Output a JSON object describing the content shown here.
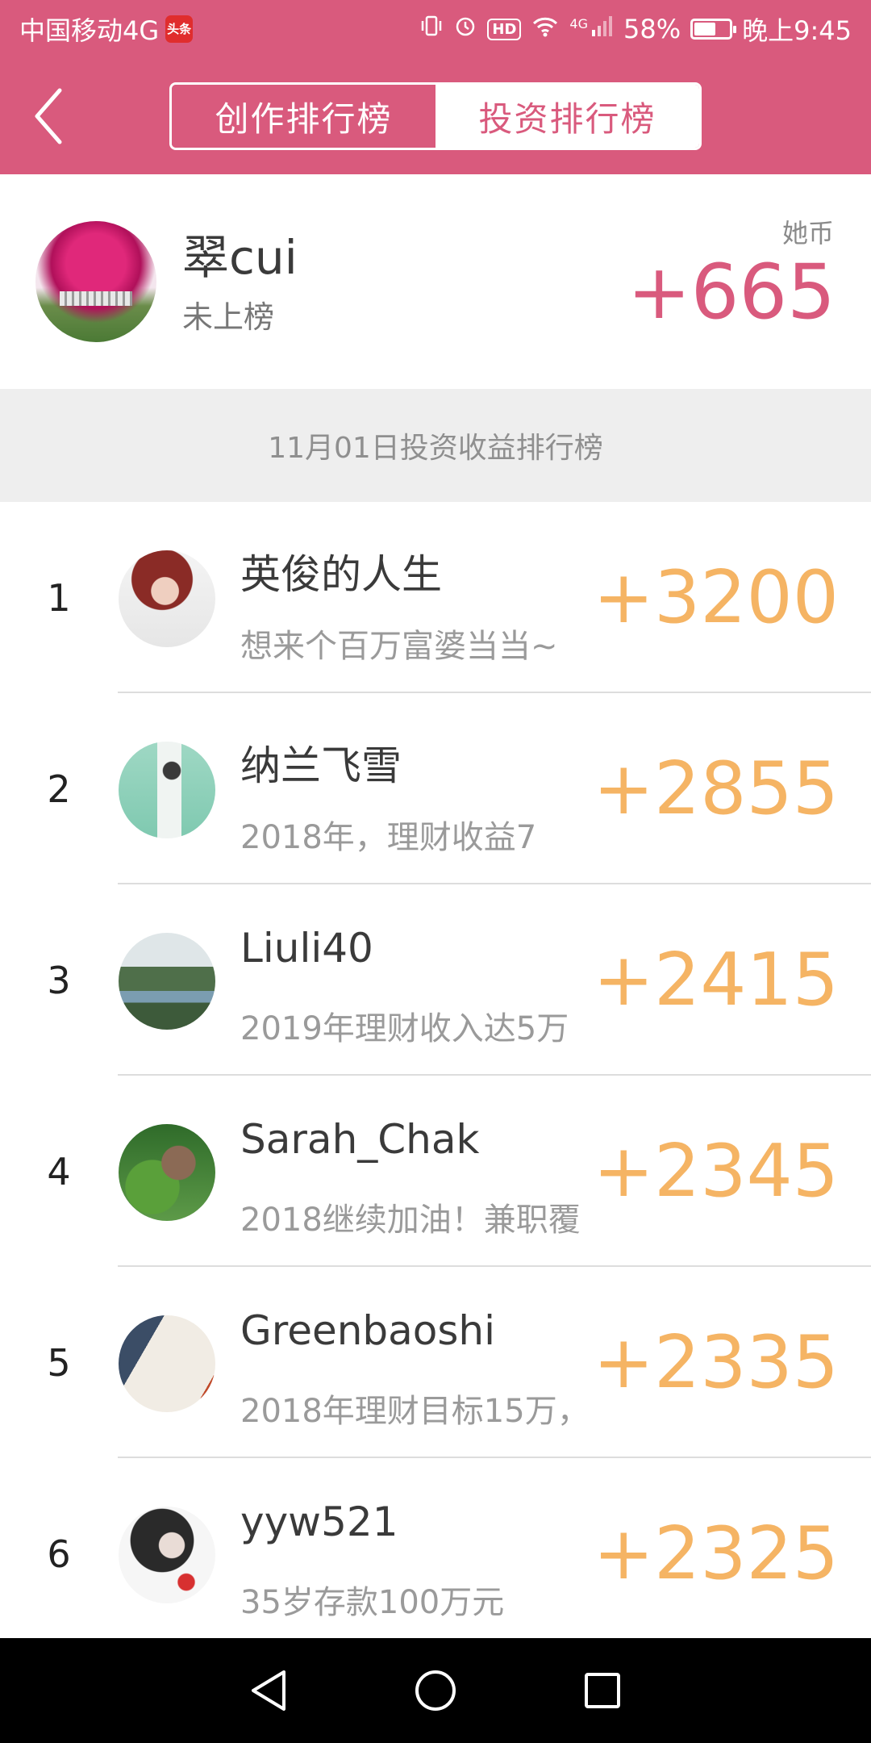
{
  "status_bar": {
    "carrier": "中国移动4G",
    "app_badge": "头条",
    "network": "4G",
    "battery_percent": "58%",
    "battery_level": 0.58,
    "time": "晚上9:45",
    "hd_label": "HD"
  },
  "header": {
    "tabs": [
      {
        "label": "创作排行榜",
        "active": false
      },
      {
        "label": "投资排行榜",
        "active": true
      }
    ],
    "accent_color": "#d95a7d"
  },
  "profile": {
    "name": "翠cui",
    "status": "未上榜",
    "coin_label": "她币",
    "amount": "+665"
  },
  "section_title": "11月01日投资收益排行榜",
  "ranking": [
    {
      "rank": "1",
      "name": "英俊的人生",
      "desc": "想来个百万富婆当当~",
      "amount": "+3200"
    },
    {
      "rank": "2",
      "name": "纳兰飞雪",
      "desc": "2018年，理财收益7",
      "amount": "+2855"
    },
    {
      "rank": "3",
      "name": "Liuli40",
      "desc": "2019年理财收入达5万",
      "amount": "+2415"
    },
    {
      "rank": "4",
      "name": "Sarah_Chak",
      "desc": "2018继续加油！兼职覆",
      "amount": "+2345"
    },
    {
      "rank": "5",
      "name": "Greenbaoshi",
      "desc": "2018年理财目标15万，",
      "amount": "+2335"
    },
    {
      "rank": "6",
      "name": "yyw521",
      "desc": "35岁存款100万元",
      "amount": "+2325"
    }
  ],
  "icons": {
    "back": "chevron-left-icon",
    "nav_back": "triangle-back-icon",
    "nav_home": "circle-home-icon",
    "nav_recent": "square-recent-icon"
  },
  "colors": {
    "amount_orange": "#f5b464",
    "profile_amount_pink": "#d95a7d"
  }
}
